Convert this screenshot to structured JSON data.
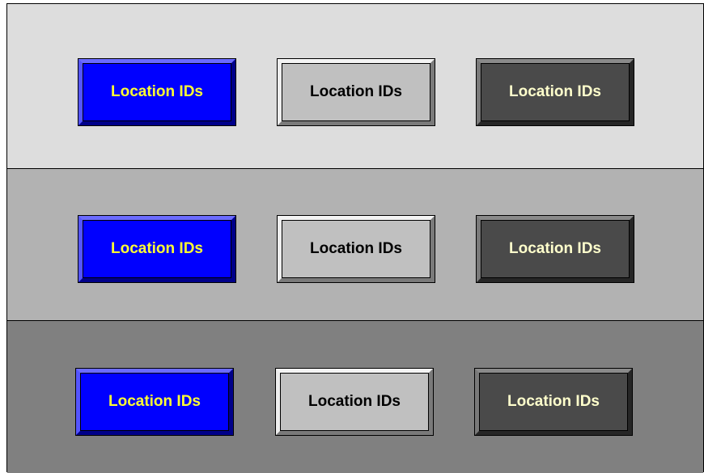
{
  "rows": [
    {
      "band_color": "#dddddd",
      "buttons": [
        {
          "label": "Location IDs",
          "style": "blue"
        },
        {
          "label": "Location IDs",
          "style": "light"
        },
        {
          "label": "Location IDs",
          "style": "dark"
        }
      ]
    },
    {
      "band_color": "#b2b2b2",
      "buttons": [
        {
          "label": "Location IDs",
          "style": "blue"
        },
        {
          "label": "Location IDs",
          "style": "light"
        },
        {
          "label": "Location IDs",
          "style": "dark"
        }
      ]
    },
    {
      "band_color": "#808080",
      "buttons": [
        {
          "label": "Location IDs",
          "style": "blue"
        },
        {
          "label": "Location IDs",
          "style": "light"
        },
        {
          "label": "Location IDs",
          "style": "dark"
        }
      ]
    }
  ],
  "colors": {
    "blue_face": "#0000ff",
    "blue_text": "#ffff33",
    "light_face": "#c0c0c0",
    "light_text": "#000000",
    "dark_face": "#4a4a4a",
    "dark_text": "#ffffcc"
  }
}
